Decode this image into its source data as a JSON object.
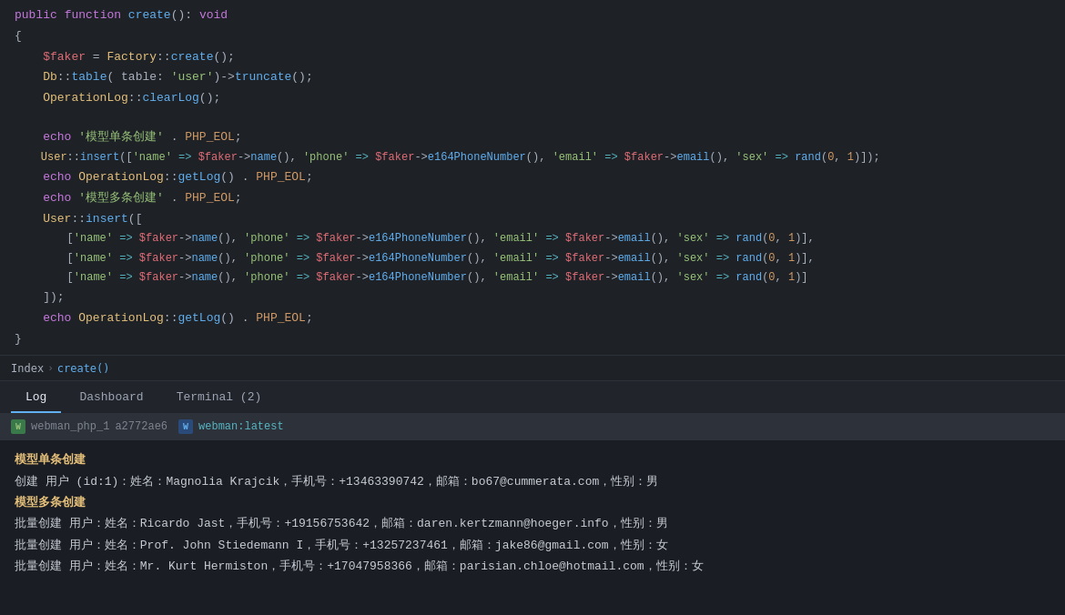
{
  "code": {
    "lines": [
      {
        "type": "function-def",
        "content": "public function create(): void"
      },
      {
        "type": "brace-open",
        "content": "{"
      },
      {
        "type": "code",
        "content": "    $faker = Factory::create();"
      },
      {
        "type": "code",
        "content": "    Db::table( table: 'user')->truncate();"
      },
      {
        "type": "code",
        "content": "    OperationLog::clearLog();"
      },
      {
        "type": "empty"
      },
      {
        "type": "code",
        "content": "    echo '模型单条创建' . PHP_EOL;"
      },
      {
        "type": "code",
        "content": "    User::insert(['name' => $faker->name(), 'phone' => $faker->e164PhoneNumber(), 'email' => $faker->email(), 'sex' => rand(0, 1)]);"
      },
      {
        "type": "code",
        "content": "    echo OperationLog::getLog() . PHP_EOL;"
      },
      {
        "type": "code",
        "content": "    echo '模型多条创建' . PHP_EOL;"
      },
      {
        "type": "code",
        "content": "    User::insert(["
      },
      {
        "type": "code",
        "content": "        ['name' => $faker->name(), 'phone' => $faker->e164PhoneNumber(), 'email' => $faker->email(), 'sex' => rand(0, 1)],"
      },
      {
        "type": "code",
        "content": "        ['name' => $faker->name(), 'phone' => $faker->e164PhoneNumber(), 'email' => $faker->email(), 'sex' => rand(0, 1)],"
      },
      {
        "type": "code",
        "content": "        ['name' => $faker->name(), 'phone' => $faker->e164PhoneNumber(), 'email' => $faker->email(), 'sex' => rand(0, 1)]"
      },
      {
        "type": "code",
        "content": "    ]);"
      },
      {
        "type": "code",
        "content": "    echo OperationLog::getLog() . PHP_EOL;"
      },
      {
        "type": "brace-close",
        "content": "}"
      }
    ]
  },
  "breadcrumb": {
    "items": [
      "Index",
      "create()"
    ]
  },
  "tabs": {
    "items": [
      "Log",
      "Dashboard",
      "Terminal (2)"
    ],
    "active": 0
  },
  "terminal": {
    "status_bars": [
      {
        "icon": "W",
        "icon_class": "badge-green",
        "name": "webman_php_1",
        "hash": "a2772ae6"
      },
      {
        "icon": "W",
        "icon_class": "badge-blue",
        "name": "webman:latest"
      }
    ],
    "output_lines": [
      {
        "text": "模型单条创建",
        "class": "term-title"
      },
      {
        "text": "创建 用户 (id:1)：姓名：Magnolia Krajcik，手机号：+13463390742，邮箱：bo67@cummerata.com，性别：男",
        "class": "term-normal"
      },
      {
        "text": "模型多条创建",
        "class": "term-title"
      },
      {
        "text": "批量创建 用户：姓名：Ricardo Jast，手机号：+19156753642，邮箱：daren.kertzmann@hoeger.info，性别：男",
        "class": "term-normal"
      },
      {
        "text": "批量创建 用户：姓名：Prof. John Stiedemann I，手机号：+13257237461，邮箱：jake86@gmail.com，性别：女",
        "class": "term-normal"
      },
      {
        "text": "批量创建 用户：姓名：Mr. Kurt Hermiston，手机号：+17047958366，邮箱：parisian.chloe@hotmail.com，性别：女",
        "class": "term-normal"
      }
    ]
  }
}
